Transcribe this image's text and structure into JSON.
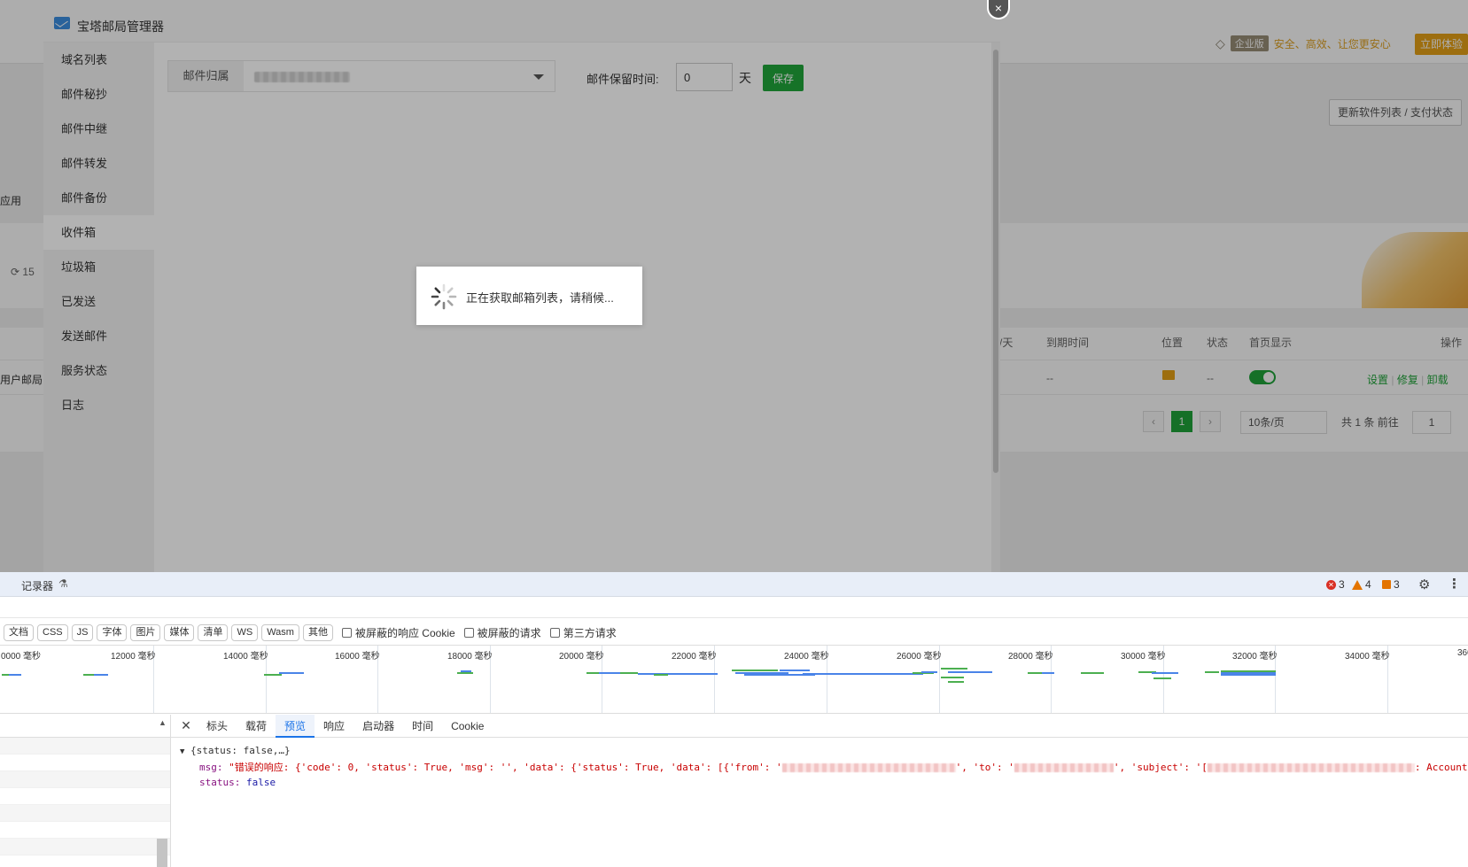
{
  "background": {
    "enterprise_badge": "企业版",
    "slogan": "安全、高效、让您更安心",
    "trial_button": "立即体验",
    "update_button": "更新软件列表 / 支付状态",
    "left_label": "应用",
    "count_prefix": "15",
    "user_row_label": "用户邮局",
    "table_headers": {
      "per_day": "/天",
      "expire": "到期时间",
      "location": "位置",
      "status": "状态",
      "home_display": "首页显示",
      "actions": "操作"
    },
    "row": {
      "per_day_value": "",
      "expire_value": "--",
      "status_value": "--",
      "action_settings": "设置",
      "action_repair": "修复",
      "action_uninstall": "卸载"
    },
    "pager": {
      "prev": "‹",
      "current_page": "1",
      "next": "›",
      "page_size": "10条/页",
      "total": "共 1 条",
      "goto_label": "前往",
      "goto_value": "1"
    }
  },
  "modal": {
    "title": "宝塔邮局管理器",
    "close_glyph": "×",
    "sidebar": [
      {
        "label": "域名列表",
        "active": false
      },
      {
        "label": "邮件秘抄",
        "active": false
      },
      {
        "label": "邮件中继",
        "active": false
      },
      {
        "label": "邮件转发",
        "active": false
      },
      {
        "label": "邮件备份",
        "active": false
      },
      {
        "label": "收件箱",
        "active": true
      },
      {
        "label": "垃圾箱",
        "active": false
      },
      {
        "label": "已发送",
        "active": false
      },
      {
        "label": "发送邮件",
        "active": false
      },
      {
        "label": "服务状态",
        "active": false
      },
      {
        "label": "日志",
        "active": false
      }
    ],
    "mail_owner_label": "邮件归属",
    "keep_time_label": "邮件保留时间:",
    "keep_time_value": "0",
    "keep_time_unit": "天",
    "save_button": "保存",
    "loading_text": "正在获取邮箱列表，请稍候..."
  },
  "devtools": {
    "recorder_label": "记录器",
    "errors": "3",
    "warnings": "4",
    "issues": "3",
    "type_filters": [
      "文档",
      "CSS",
      "JS",
      "字体",
      "图片",
      "媒体",
      "清单",
      "WS",
      "Wasm",
      "其他"
    ],
    "checkboxes": [
      "被屏蔽的响应 Cookie",
      "被屏蔽的请求",
      "第三方请求"
    ],
    "timeline_ticks": [
      "0000 毫秒",
      "12000 毫秒",
      "14000 毫秒",
      "16000 毫秒",
      "18000 毫秒",
      "20000 毫秒",
      "22000 毫秒",
      "24000 毫秒",
      "26000 毫秒",
      "28000 毫秒",
      "30000 毫秒",
      "32000 毫秒",
      "34000 毫秒",
      "360"
    ],
    "detail_tabs": [
      {
        "label": "标头",
        "active": false
      },
      {
        "label": "载荷",
        "active": false
      },
      {
        "label": "预览",
        "active": true
      },
      {
        "label": "响应",
        "active": false
      },
      {
        "label": "启动器",
        "active": false
      },
      {
        "label": "时间",
        "active": false
      },
      {
        "label": "Cookie",
        "active": false
      }
    ],
    "preview": {
      "root_line": "{status: false,…}",
      "msg_key": "msg:",
      "msg_part1": "\"错误的响应: {'code': 0, 'status': True, 'msg': '', 'data': {'status': True, 'data': [{'from': '",
      "msg_part2": "', 'to': '",
      "msg_part3": "', 'subject': '[",
      "msg_part4": ": Account',",
      "status_key": "status:",
      "status_value": "false"
    }
  }
}
